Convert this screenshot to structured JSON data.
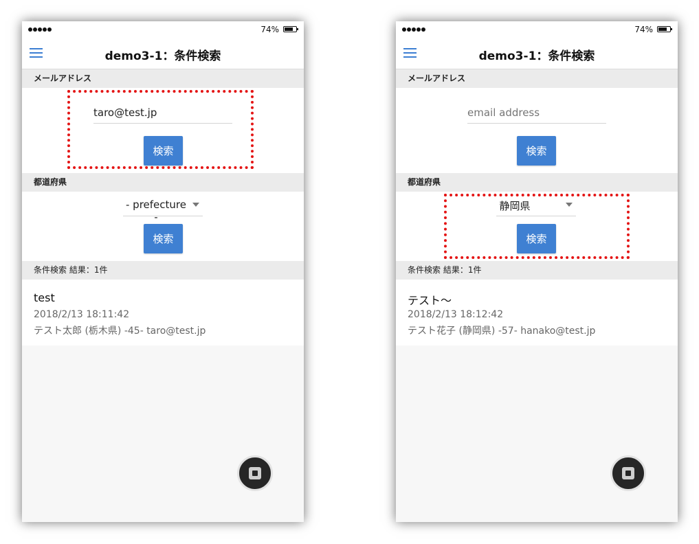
{
  "screens": [
    {
      "status": {
        "battery": "74%"
      },
      "header": {
        "title": "demo3-1：条件検索"
      },
      "email_section": {
        "label": "メールアドレス",
        "value": "taro@test.jp",
        "placeholder": "email address",
        "button": "検索"
      },
      "prefecture_section": {
        "label": "都道府県",
        "selected": "- prefecture -",
        "button": "検索"
      },
      "result_header": "条件検索 結果：1件",
      "result": {
        "title": "test",
        "date": "2018/2/13 18:11:42",
        "meta": "テスト太郎 (栃木県) -45- taro@test.jp"
      },
      "highlight": "email"
    },
    {
      "status": {
        "battery": "74%"
      },
      "header": {
        "title": "demo3-1：条件検索"
      },
      "email_section": {
        "label": "メールアドレス",
        "value": "",
        "placeholder": "email address",
        "button": "検索"
      },
      "prefecture_section": {
        "label": "都道府県",
        "selected": "静岡県",
        "button": "検索"
      },
      "result_header": "条件検索 結果：1件",
      "result": {
        "title": "テスト〜",
        "date": "2018/2/13 18:12:42",
        "meta": "テスト花子 (静岡県) -57- hanako@test.jp"
      },
      "highlight": "prefecture"
    }
  ],
  "colors": {
    "accent": "#3f80d2",
    "highlight": "#e41515",
    "section_bg": "#ebebeb"
  },
  "icons": {
    "menu": "hamburger-icon",
    "select": "chevron-down-icon",
    "record": "stop-icon"
  }
}
